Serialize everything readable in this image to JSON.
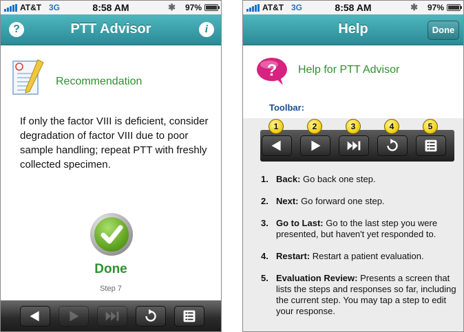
{
  "status_bar": {
    "carrier": "AT&T",
    "network": "3G",
    "time": "8:58 AM",
    "battery": "97%",
    "battery_level": 0.97
  },
  "left_screen": {
    "title": "PTT Advisor",
    "help_icon": "question-icon",
    "info_icon": "info-icon",
    "recommendation_label": "Recommendation",
    "recommendation_text": "If only the factor VIII is deficient, consider degradation of factor VIII due to poor sample handling; repeat PTT with freshly collected specimen.",
    "done_label": "Done",
    "step_label": "Step 7",
    "toolbar": [
      {
        "icon": "back-arrow-icon",
        "enabled": true
      },
      {
        "icon": "next-arrow-icon",
        "enabled": false
      },
      {
        "icon": "go-to-last-icon",
        "enabled": false
      },
      {
        "icon": "restart-icon",
        "enabled": true
      },
      {
        "icon": "evaluation-review-icon",
        "enabled": true
      }
    ]
  },
  "right_screen": {
    "title": "Help",
    "done_button": "Done",
    "help_heading": "Help for PTT Advisor",
    "toolbar_label": "Toolbar:",
    "badges": [
      "1",
      "2",
      "3",
      "4",
      "5"
    ],
    "items": [
      {
        "num": "1.",
        "term": "Back:",
        "desc": "Go back one step."
      },
      {
        "num": "2.",
        "term": "Next:",
        "desc": "Go forward one step."
      },
      {
        "num": "3.",
        "term": "Go to Last:",
        "desc": "Go to the last step you were presented, but haven't yet responded to."
      },
      {
        "num": "4.",
        "term": "Restart:",
        "desc": "Restart a patient evaluation."
      },
      {
        "num": "5.",
        "term": "Evaluation Review:",
        "desc": "Presents a screen that lists the steps and responses so far, including the current step. You may tap a step to edit your response."
      }
    ]
  },
  "colors": {
    "nav_teal": "#2a8b96",
    "green_text": "#2e8f2e",
    "badge_yellow": "#f3d21c",
    "toolbar_label_blue": "#1e4e8a"
  }
}
